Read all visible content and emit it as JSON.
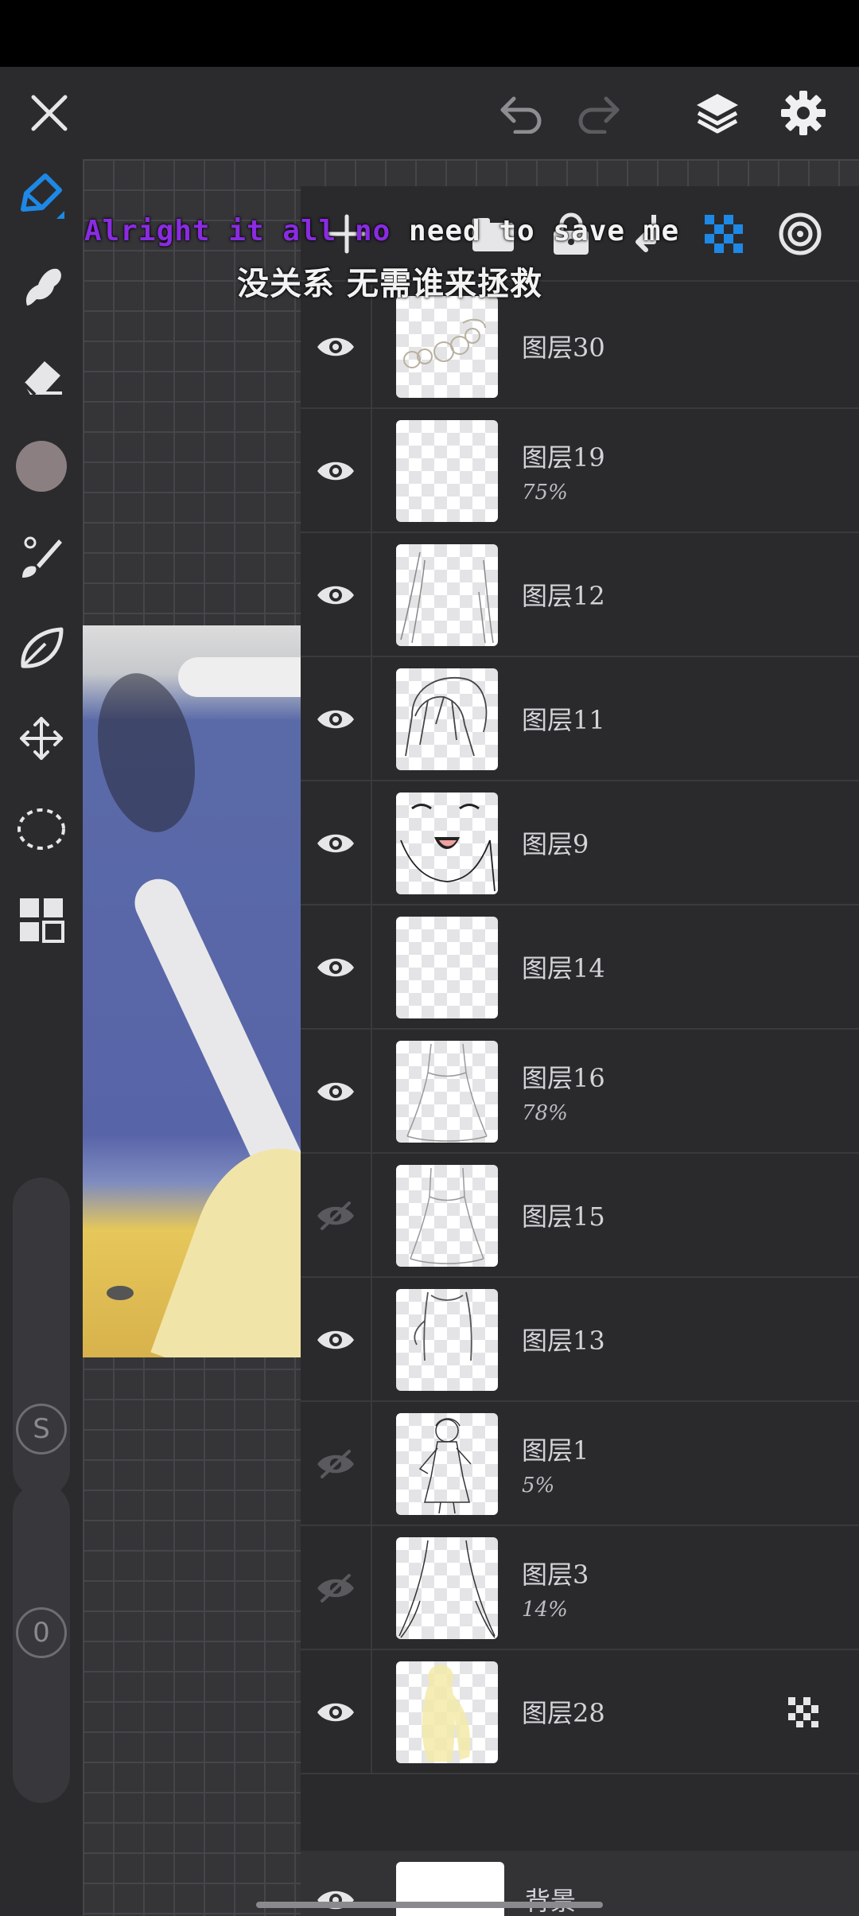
{
  "lyrics": {
    "english_sung": "Alright it all no",
    "english_rest": " need to save me",
    "chinese": "没关系 无需谁来拯救"
  },
  "top_toolbar": {
    "close": "close-icon",
    "undo": "undo-icon",
    "redo": "redo-icon",
    "layers": "layers-icon",
    "settings": "gear-icon"
  },
  "tools": [
    {
      "name": "pen",
      "icon": "pen-icon",
      "active": true
    },
    {
      "name": "smudge",
      "icon": "smudge-icon"
    },
    {
      "name": "eraser",
      "icon": "eraser-icon"
    },
    {
      "name": "color",
      "icon": "color-swatch",
      "color": "#8c7f82"
    },
    {
      "name": "brush",
      "icon": "brush-icon"
    },
    {
      "name": "lasso-fill",
      "icon": "leaf-icon"
    },
    {
      "name": "transform",
      "icon": "move-icon"
    },
    {
      "name": "selection",
      "icon": "lasso-icon"
    },
    {
      "name": "gallery",
      "icon": "grid-icon"
    }
  ],
  "sliders": {
    "size_label": "S",
    "opacity_label": "0"
  },
  "layer_toolbar": [
    "add-layer-icon",
    "folder-icon",
    "lock-icon",
    "merge-down-icon",
    "alpha-lock-icon",
    "target-icon"
  ],
  "layers": [
    {
      "name": "图层30",
      "opacity": "",
      "visible": true
    },
    {
      "name": "图层19",
      "opacity": "75%",
      "visible": true
    },
    {
      "name": "图层12",
      "opacity": "",
      "visible": true
    },
    {
      "name": "图层11",
      "opacity": "",
      "visible": true
    },
    {
      "name": "图层9",
      "opacity": "",
      "visible": true
    },
    {
      "name": "图层14",
      "opacity": "",
      "visible": true
    },
    {
      "name": "图层16",
      "opacity": "78%",
      "visible": true
    },
    {
      "name": "图层15",
      "opacity": "",
      "visible": false
    },
    {
      "name": "图层13",
      "opacity": "",
      "visible": true
    },
    {
      "name": "图层1",
      "opacity": "5%",
      "visible": false
    },
    {
      "name": "图层3",
      "opacity": "14%",
      "visible": false
    },
    {
      "name": "图层28",
      "opacity": "",
      "visible": true,
      "alpha_locked": true
    }
  ],
  "background_layer": {
    "name": "背景",
    "visible": true
  },
  "colors": {
    "accent": "#1e88e5",
    "panel": "#2a2a2d",
    "text": "#d4d4d8"
  }
}
